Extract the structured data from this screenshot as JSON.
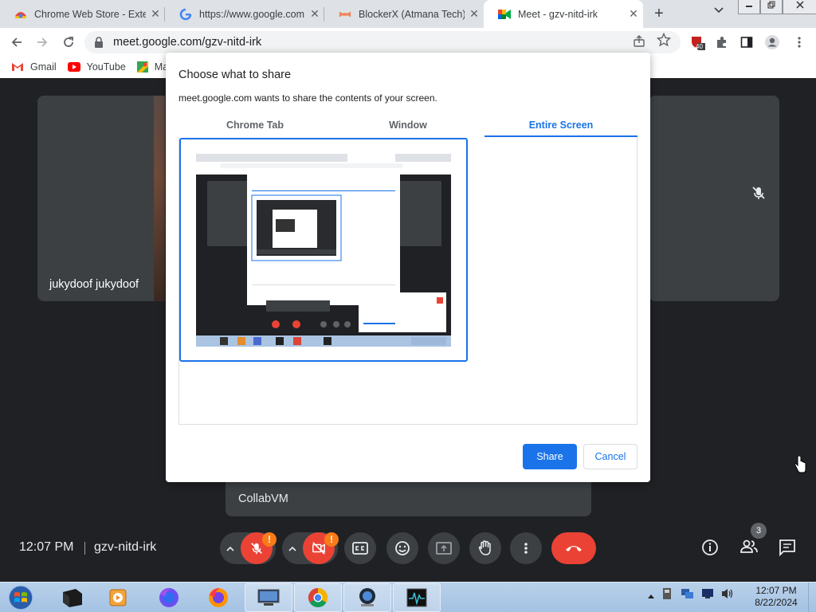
{
  "browser": {
    "tabs": [
      {
        "title": "Chrome Web Store - Extensions",
        "icon": "chrome-web-store-icon"
      },
      {
        "title": "https://www.google.com",
        "icon": "google-g-icon"
      },
      {
        "title": "BlockerX (Atmana Tech)",
        "icon": "blockerx-icon"
      },
      {
        "title": "Meet - gzv-nitd-irk",
        "icon": "google-meet-icon",
        "active": true
      }
    ],
    "tab_close_glyph": "✕",
    "new_tab_glyph": "+",
    "url": "meet.google.com/gzv-nitd-irk",
    "extension_badge": "40",
    "bookmarks": [
      {
        "label": "Gmail",
        "icon": "gmail-icon"
      },
      {
        "label": "YouTube",
        "icon": "youtube-icon"
      },
      {
        "label": "Ma",
        "icon": "google-maps-icon"
      }
    ]
  },
  "meet": {
    "participant_name": "jukydoof jukydoof",
    "presenter_tile": "CollabVM",
    "time": "12:07 PM",
    "meeting_code": "gzv-nitd-irk",
    "participant_count": "3",
    "warn_badge": "!"
  },
  "dialog": {
    "title": "Choose what to share",
    "subtitle": "meet.google.com wants to share the contents of your screen.",
    "tabs": [
      {
        "label": "Chrome Tab"
      },
      {
        "label": "Window"
      },
      {
        "label": "Entire Screen",
        "active": true
      }
    ],
    "share_label": "Share",
    "cancel_label": "Cancel"
  },
  "taskbar": {
    "time": "12:07 PM",
    "date": "8/22/2024"
  },
  "colors": {
    "accent": "#1a73e8",
    "meet_bg": "#202124",
    "end_call": "#ea4335",
    "warning": "#fa7b17"
  }
}
